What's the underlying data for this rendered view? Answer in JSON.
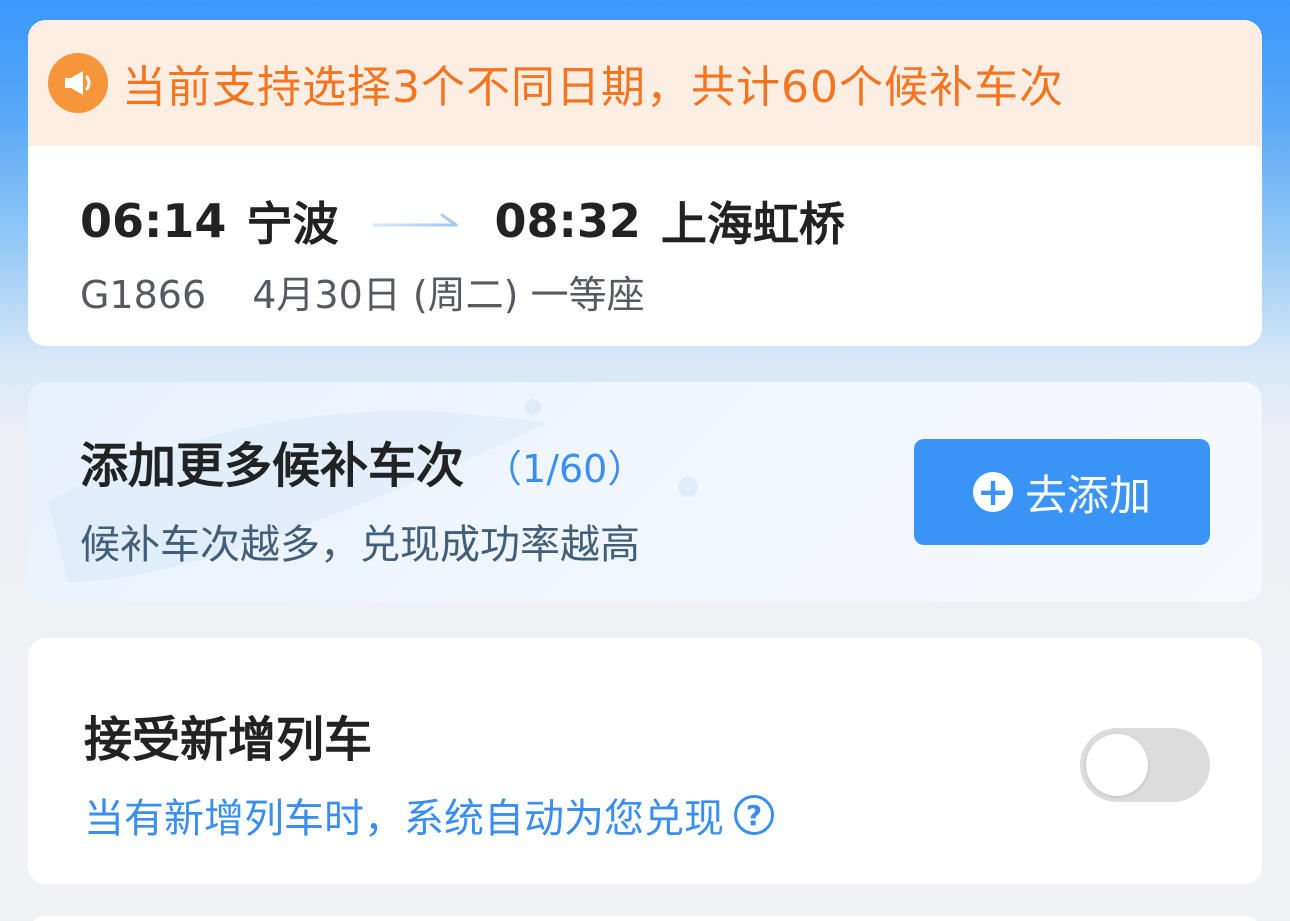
{
  "notice": {
    "icon": "megaphone-icon",
    "text": "当前支持选择3个不同日期，共计60个候补车次",
    "color": "#f4741f",
    "background": "#fdeee4"
  },
  "trip": {
    "depart_time": "06:14",
    "depart_city": "宁波",
    "arrive_time": "08:32",
    "arrive_city": "上海虹桥",
    "train_no": "G1866",
    "date_seat": "4月30日 (周二) 一等座"
  },
  "add_more": {
    "title": "添加更多候补车次",
    "count": "（1/60）",
    "subtitle": "候补车次越多，兑现成功率越高",
    "button_label": "去添加",
    "button_color": "#3a94f6"
  },
  "accept_new": {
    "title": "接受新增列车",
    "subtitle": "当有新增列车时，系统自动为您兑现",
    "help_glyph": "?",
    "toggle_on": false
  },
  "colors": {
    "accent_blue": "#3a8ef0",
    "header_blue": "#3a98fb"
  }
}
